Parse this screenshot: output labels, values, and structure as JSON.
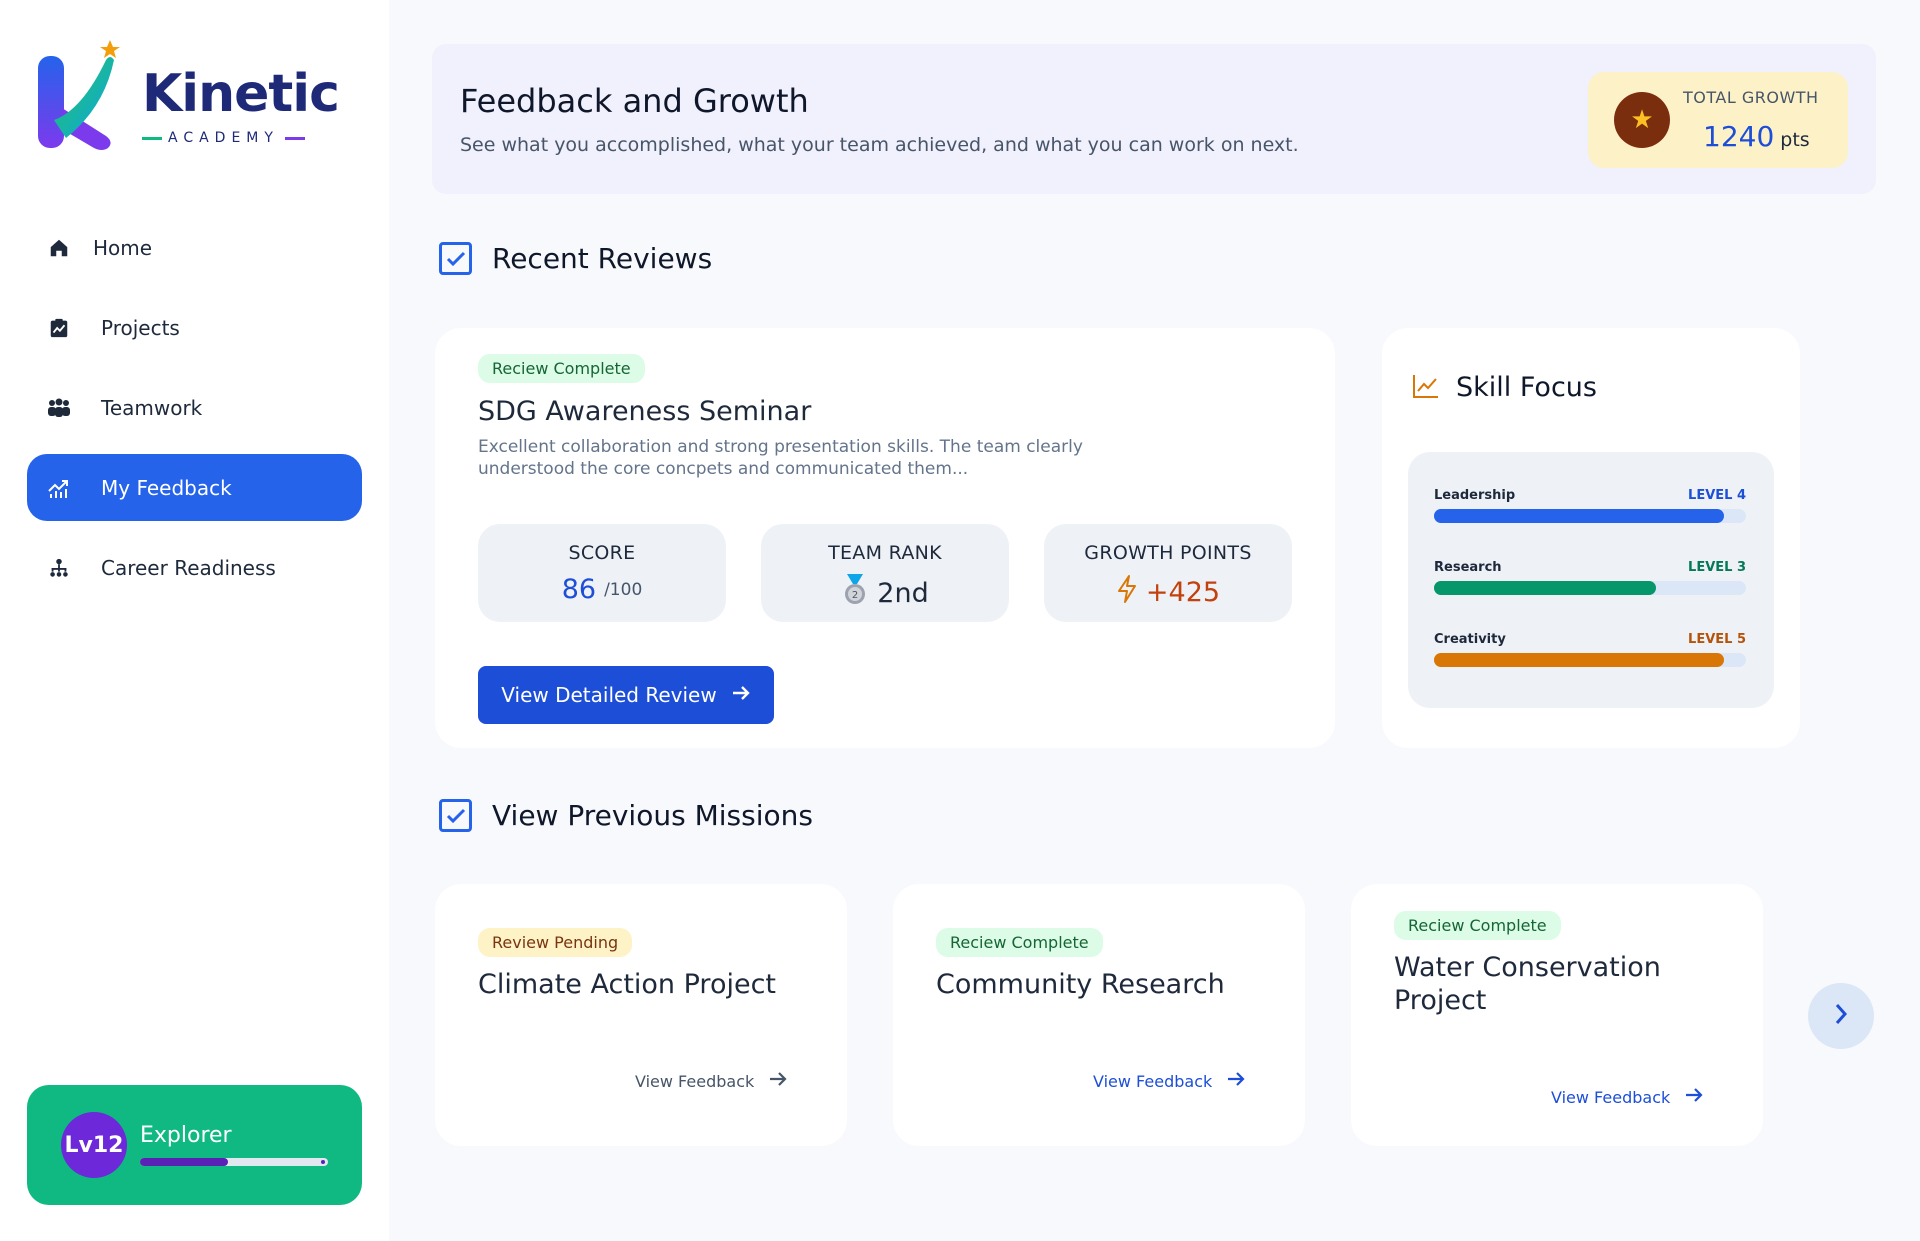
{
  "brand": {
    "name": "Kinetic",
    "tagline": "ACADEMY"
  },
  "sidebar": {
    "items": [
      {
        "label": "Home",
        "icon": "home-icon"
      },
      {
        "label": "Projects",
        "icon": "clipboard-chart-icon"
      },
      {
        "label": "Teamwork",
        "icon": "team-icon"
      },
      {
        "label": "My Feedback",
        "icon": "trend-chart-icon",
        "active": true
      },
      {
        "label": "Career Readiness",
        "icon": "hierarchy-icon"
      }
    ],
    "level": {
      "badge": "Lv12",
      "title": "Explorer",
      "progress": 0.47
    }
  },
  "header": {
    "title": "Feedback and Growth",
    "subtitle": "See what you accomplished, what your team achieved, and what you can work on next.",
    "growth_label": "TOTAL GROWTH",
    "growth_value": "1240",
    "growth_unit": "pts"
  },
  "recent": {
    "heading": "Recent Reviews",
    "badge": "Reciew Complete",
    "title": "SDG Awareness Seminar",
    "description": "Excellent collaboration and strong presentation skills. The team clearly understood the core concpets and communicated them...",
    "stats": {
      "score_label": "SCORE",
      "score_value": "86",
      "score_max": "/100",
      "rank_label": "TEAM RANK",
      "rank_value": "2nd",
      "points_label": "GROWTH POINTS",
      "points_value": "+425"
    },
    "button": "View Detailed Review"
  },
  "skills": {
    "title": "Skill Focus",
    "items": [
      {
        "name": "Leadership",
        "level": "LEVEL 4",
        "progress": 0.93,
        "color": "#2563eb",
        "level_color": "#1d4ed8"
      },
      {
        "name": "Research",
        "level": "LEVEL 3",
        "progress": 0.71,
        "color": "#059669",
        "level_color": "#047857"
      },
      {
        "name": "Creativity",
        "level": "LEVEL 5",
        "progress": 0.93,
        "color": "#d97706",
        "level_color": "#b45309"
      }
    ]
  },
  "missions": {
    "heading": "View Previous Missions",
    "items": [
      {
        "badge": "Review Pending",
        "status": "pending",
        "title": "Climate Action Project",
        "link": "View Feedback"
      },
      {
        "badge": "Reciew Complete",
        "status": "complete",
        "title": "Community Research",
        "link": "View Feedback"
      },
      {
        "badge": "Reciew Complete",
        "status": "complete",
        "title": "Water Conservation Project",
        "link": "View Feedback"
      }
    ]
  },
  "colors": {
    "primary": "#2563eb",
    "sidebar_active": "#2563eb",
    "level_card": "#10b981",
    "growth_box": "#fdf1c7"
  }
}
